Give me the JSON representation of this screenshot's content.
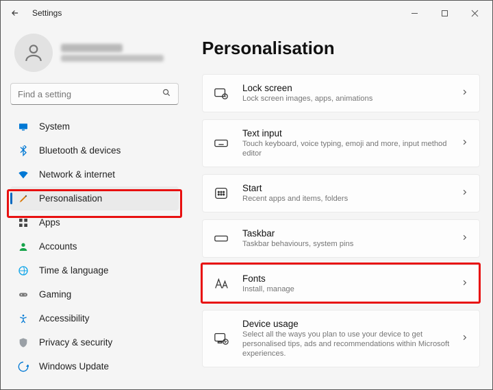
{
  "titlebar": {
    "title": "Settings"
  },
  "search": {
    "placeholder": "Find a setting"
  },
  "nav": {
    "items": [
      {
        "label": "System"
      },
      {
        "label": "Bluetooth & devices"
      },
      {
        "label": "Network & internet"
      },
      {
        "label": "Personalisation"
      },
      {
        "label": "Apps"
      },
      {
        "label": "Accounts"
      },
      {
        "label": "Time & language"
      },
      {
        "label": "Gaming"
      },
      {
        "label": "Accessibility"
      },
      {
        "label": "Privacy & security"
      },
      {
        "label": "Windows Update"
      }
    ]
  },
  "page": {
    "title": "Personalisation"
  },
  "cards": {
    "lock": {
      "title": "Lock screen",
      "sub": "Lock screen images, apps, animations"
    },
    "text": {
      "title": "Text input",
      "sub": "Touch keyboard, voice typing, emoji and more, input method editor"
    },
    "start": {
      "title": "Start",
      "sub": "Recent apps and items, folders"
    },
    "taskbar": {
      "title": "Taskbar",
      "sub": "Taskbar behaviours, system pins"
    },
    "fonts": {
      "title": "Fonts",
      "sub": "Install, manage"
    },
    "device": {
      "title": "Device usage",
      "sub": "Select all the ways you plan to use your device to get personalised tips, ads and recommendations within Microsoft experiences."
    }
  }
}
